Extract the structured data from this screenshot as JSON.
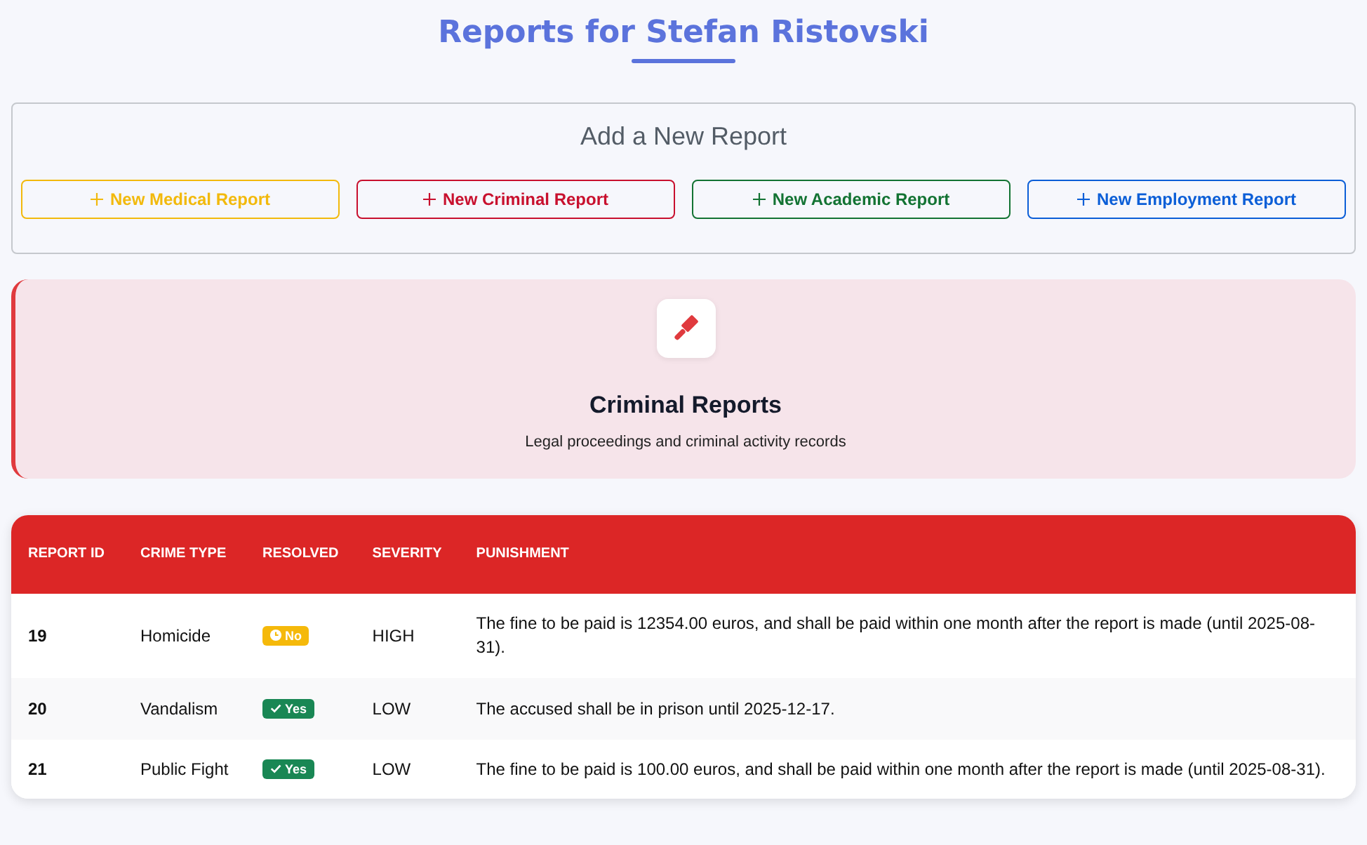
{
  "page_title": "Reports for Stefan Ristovski",
  "add_section": {
    "heading": "Add a New Report",
    "buttons": [
      {
        "label": "New Medical Report",
        "color": "#f2b90c"
      },
      {
        "label": "New Criminal Report",
        "color": "#c8102e"
      },
      {
        "label": "New Academic Report",
        "color": "#137333"
      },
      {
        "label": "New Employment Report",
        "color": "#0b5ed7"
      }
    ]
  },
  "category_card": {
    "title": "Criminal Reports",
    "subtitle": "Legal proceedings and criminal activity records"
  },
  "table": {
    "columns": [
      "REPORT ID",
      "CRIME TYPE",
      "RESOLVED",
      "SEVERITY",
      "PUNISHMENT"
    ],
    "rows": [
      {
        "id": "19",
        "crime_type": "Homicide",
        "resolved": false,
        "resolved_label": "No",
        "severity": "HIGH",
        "punishment": "The fine to be paid is 12354.00 euros, and shall be paid within one month after the report is made (until 2025-08-31)."
      },
      {
        "id": "20",
        "crime_type": "Vandalism",
        "resolved": true,
        "resolved_label": "Yes",
        "severity": "LOW",
        "punishment": "The accused shall be in prison until 2025-12-17."
      },
      {
        "id": "21",
        "crime_type": "Public Fight",
        "resolved": true,
        "resolved_label": "Yes",
        "severity": "LOW",
        "punishment": "The fine to be paid is 100.00 euros, and shall be paid within one month after the report is made (until 2025-08-31)."
      }
    ]
  }
}
